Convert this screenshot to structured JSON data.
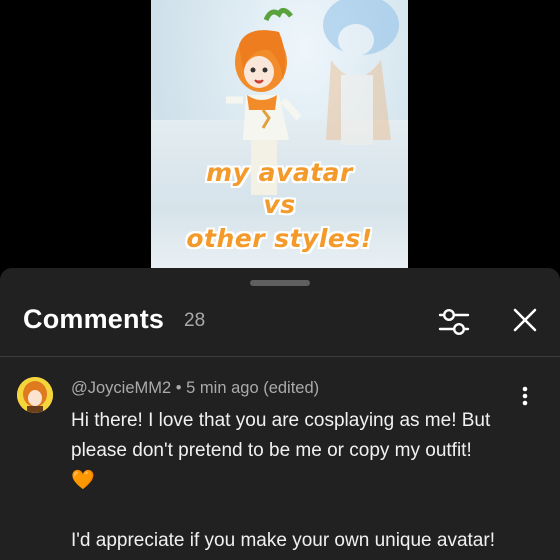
{
  "video": {
    "overlay_lines": [
      "my avatar",
      "vs",
      "other styles!"
    ],
    "overlay_color": "#f39a2a"
  },
  "comments_panel": {
    "title": "Comments",
    "count": "28",
    "filter_icon": "sliders-icon",
    "close_icon": "close-icon"
  },
  "comment": {
    "author": "@JoycieMM2",
    "separator": "•",
    "time": "5 min ago (edited)",
    "line1": "Hi there! I love that you are cosplaying as me! But please don't pretend to be me or copy my outfit!",
    "heart": "🧡",
    "line2": "I'd appreciate if you make your own unique avatar!",
    "more_icon": "more-vert-icon",
    "avatar_icon": "user-avatar"
  },
  "colors": {
    "panel_bg": "#212121",
    "text_primary": "#f1f1f1",
    "text_secondary": "#aaaaaa",
    "accent_orange": "#f39a2a"
  }
}
